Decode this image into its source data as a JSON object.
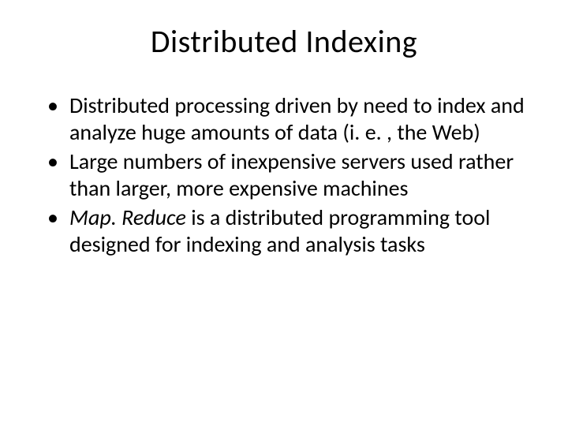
{
  "slide": {
    "title": "Distributed Indexing",
    "bullets": [
      {
        "text": "Distributed processing driven by need to index and analyze huge amounts of data (i. e. , the Web)"
      },
      {
        "text": "Large numbers of inexpensive servers used rather than larger, more expensive machines"
      },
      {
        "italic_lead": "Map. Reduce",
        "rest": " is a distributed programming tool designed for indexing and analysis tasks"
      }
    ]
  }
}
